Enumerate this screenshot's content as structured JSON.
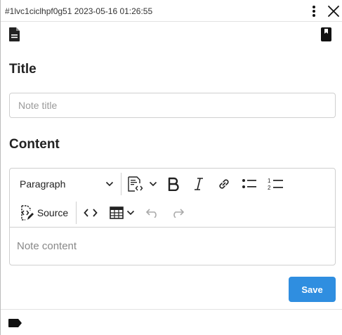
{
  "window": {
    "meta": "#1lvc1ciclhpf0g51 2023-05-16 01:26:55",
    "icons": {
      "menu": "more-vertical-icon",
      "close": "close-icon"
    }
  },
  "header_icons": {
    "left": "note-file-icon",
    "right": "notebook-icon"
  },
  "form": {
    "title_label": "Title",
    "title_placeholder": "Note title",
    "title_value": "",
    "content_label": "Content",
    "content_placeholder": "Note content"
  },
  "editor_toolbar": {
    "heading_select": "Paragraph",
    "source_label": "Source",
    "items": [
      "insert-template",
      "bold",
      "italic",
      "link",
      "bulleted-list",
      "numbered-list",
      "code",
      "table",
      "undo",
      "redo"
    ]
  },
  "actions": {
    "save_label": "Save"
  },
  "footer": {
    "icon": "tag-icon"
  },
  "colors": {
    "accent": "#2f8ee0",
    "border": "#cfcfcf",
    "text": "#222222"
  }
}
